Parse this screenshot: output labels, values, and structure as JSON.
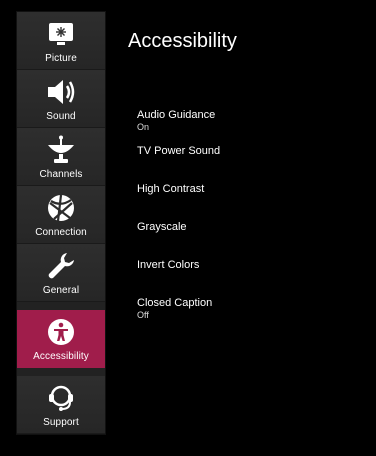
{
  "sidebar": {
    "items": [
      {
        "label": "Picture",
        "icon": "picture-icon"
      },
      {
        "label": "Sound",
        "icon": "speaker-icon"
      },
      {
        "label": "Channels",
        "icon": "satellite-dish-icon"
      },
      {
        "label": "Connection",
        "icon": "globe-network-icon"
      },
      {
        "label": "General",
        "icon": "wrench-icon"
      },
      {
        "label": "Accessibility",
        "icon": "accessibility-icon",
        "active": true
      },
      {
        "label": "Support",
        "icon": "headset-support-icon"
      }
    ]
  },
  "page": {
    "title": "Accessibility"
  },
  "menu": {
    "items": [
      {
        "label": "Audio Guidance",
        "value": "On"
      },
      {
        "label": "TV Power Sound",
        "value": ""
      },
      {
        "label": "High Contrast",
        "value": ""
      },
      {
        "label": "Grayscale",
        "value": ""
      },
      {
        "label": "Invert Colors",
        "value": ""
      },
      {
        "label": "Closed Caption",
        "value": "Off"
      }
    ]
  },
  "colors": {
    "accent": "#a01d4b",
    "sidebar_bg": "#2a2a2a",
    "background": "#000000"
  }
}
